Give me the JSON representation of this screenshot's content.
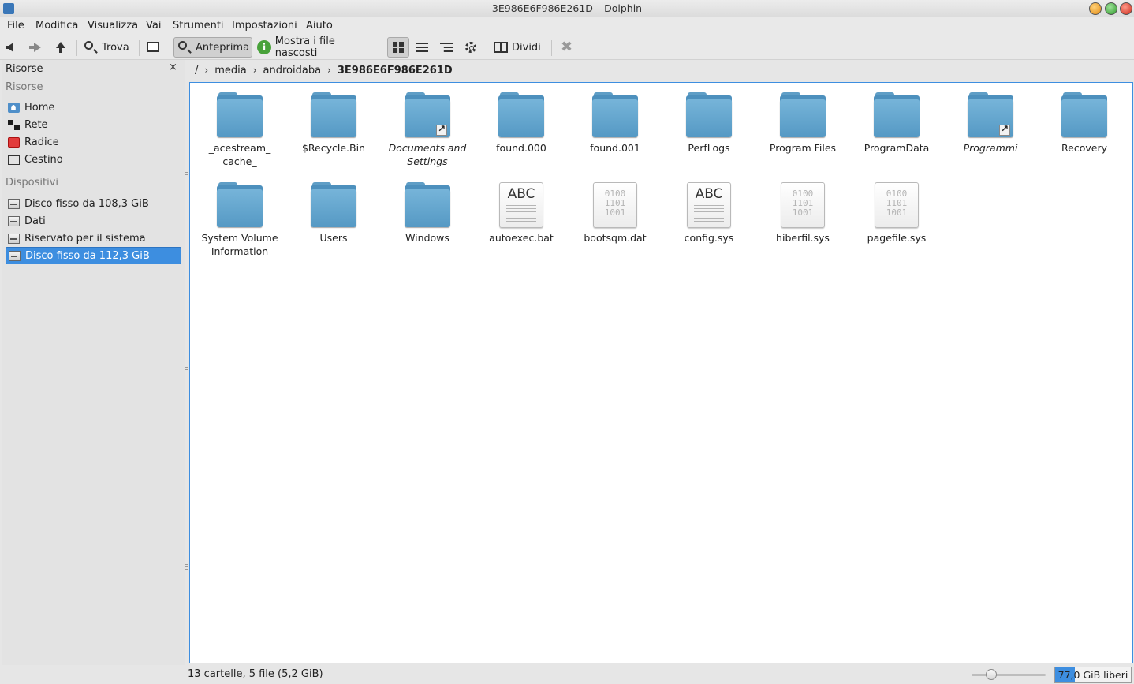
{
  "window": {
    "title": "3E986E6F986E261D – Dolphin"
  },
  "menu": [
    "File",
    "Modifica",
    "Visualizza",
    "Vai",
    "Strumenti",
    "Impostazioni",
    "Aiuto"
  ],
  "toolbar": {
    "find_label": "Trova",
    "preview_label": "Anteprima",
    "hidden_label": "Mostra i file nascosti",
    "split_label": "Dividi"
  },
  "sidebar": {
    "header": "Risorse",
    "close": "×",
    "section_places": "Risorse",
    "places": [
      {
        "label": "Home",
        "icon": "home-icon"
      },
      {
        "label": "Rete",
        "icon": "network-icon"
      },
      {
        "label": "Radice",
        "icon": "root-folder-icon"
      },
      {
        "label": "Cestino",
        "icon": "trash-icon"
      }
    ],
    "section_devices": "Dispositivi",
    "devices": [
      {
        "label": "Disco fisso da 108,3 GiB",
        "icon": "hard-disk-icon"
      },
      {
        "label": "Dati",
        "icon": "hard-disk-icon"
      },
      {
        "label": "Riservato per il sistema",
        "icon": "hard-disk-icon"
      },
      {
        "label": "Disco fisso da 112,3 GiB",
        "icon": "hard-disk-icon",
        "selected": true
      }
    ]
  },
  "breadcrumb": [
    "/",
    "media",
    "androidaba",
    "3E986E6F986E261D"
  ],
  "files": [
    {
      "name": "_acestream_ cache_",
      "type": "folder"
    },
    {
      "name": "$Recycle.Bin",
      "type": "folder"
    },
    {
      "name": "Documents and Settings",
      "type": "folder-link"
    },
    {
      "name": "found.000",
      "type": "folder"
    },
    {
      "name": "found.001",
      "type": "folder"
    },
    {
      "name": "PerfLogs",
      "type": "folder"
    },
    {
      "name": "Program Files",
      "type": "folder"
    },
    {
      "name": "ProgramData",
      "type": "folder"
    },
    {
      "name": "Programmi",
      "type": "folder-link"
    },
    {
      "name": "Recovery",
      "type": "folder"
    },
    {
      "name": "System Volume Information",
      "type": "folder"
    },
    {
      "name": "Users",
      "type": "folder"
    },
    {
      "name": "Windows",
      "type": "folder"
    },
    {
      "name": "autoexec.bat",
      "type": "text"
    },
    {
      "name": "bootsqm.dat",
      "type": "binary"
    },
    {
      "name": "config.sys",
      "type": "text"
    },
    {
      "name": "hiberfil.sys",
      "type": "binary"
    },
    {
      "name": "pagefile.sys",
      "type": "binary"
    }
  ],
  "icons": {
    "text_glyph": "ABC",
    "binary_glyph": "0100\n1101\n1001"
  },
  "status": {
    "summary": "13 cartelle, 5 file (5,2 GiB)",
    "free_space": "77,0 GiB liberi",
    "free_fraction": 0.26
  },
  "colors": {
    "accent": "#3d8ee0",
    "folder": "#5f9ec6"
  }
}
